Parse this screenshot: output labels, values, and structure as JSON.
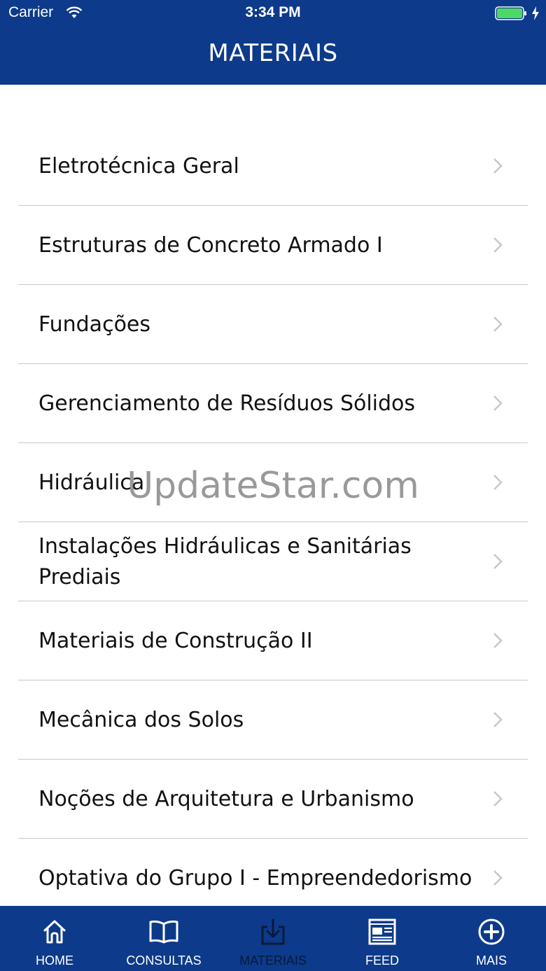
{
  "status_bar": {
    "carrier": "Carrier",
    "time": "3:34 PM"
  },
  "header": {
    "title": "MATERIAIS"
  },
  "list": {
    "items": [
      {
        "label": "Eletrotécnica Geral"
      },
      {
        "label": "Estruturas de Concreto Armado I"
      },
      {
        "label": "Fundações"
      },
      {
        "label": "Gerenciamento de Resíduos Sólidos"
      },
      {
        "label": "Hidráulica"
      },
      {
        "label": "Instalações Hidráulicas e Sanitárias Prediais"
      },
      {
        "label": "Materiais de Construção II"
      },
      {
        "label": "Mecânica dos Solos"
      },
      {
        "label": "Noções de Arquitetura e Urbanismo"
      },
      {
        "label": "Optativa do Grupo I - Empreendedorismo"
      }
    ]
  },
  "watermark": "UpdateStar.com",
  "tabbar": {
    "tabs": [
      {
        "label": "HOME",
        "icon": "home-icon"
      },
      {
        "label": "CONSULTAS",
        "icon": "book-icon"
      },
      {
        "label": "MATERIAIS",
        "icon": "download-icon",
        "active": true
      },
      {
        "label": "FEED",
        "icon": "newspaper-icon"
      },
      {
        "label": "MAIS",
        "icon": "plus-circle-icon"
      }
    ]
  },
  "colors": {
    "primary": "#0d3a8a",
    "active_tab": "#081a3a",
    "battery": "#4cd964"
  }
}
